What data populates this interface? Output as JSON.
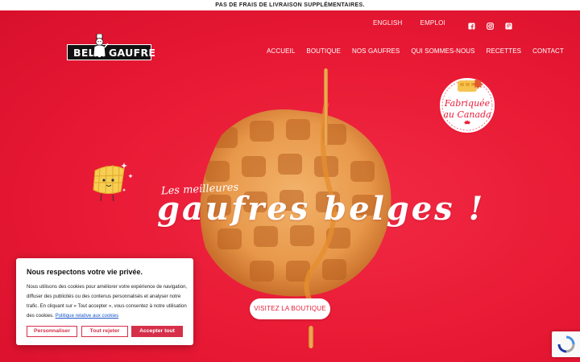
{
  "announcement": "PAS DE FRAIS DE LIVRAISON SUPPLÉMENTAIRES.",
  "top_links": [
    "ENGLISH",
    "EMPLOI"
  ],
  "social": [
    "facebook-icon",
    "instagram-icon",
    "pinterest-icon"
  ],
  "logo": {
    "left": "BEL",
    "right": "GAUFRE"
  },
  "nav": [
    "ACCUEIL",
    "BOUTIQUE",
    "NOS GAUFRES",
    "QUI SOMMES-NOUS",
    "RECETTES",
    "CONTACT"
  ],
  "badge": {
    "line1": "Fabriquée",
    "line2": "au Canada"
  },
  "hero": {
    "tagline_small": "Les meilleures",
    "tagline_big": "gaufres belges !",
    "cta": "VISITEZ LA BOUTIQUE"
  },
  "cookie": {
    "title": "Nous respectons votre vie privée.",
    "body": "Nous utilisons des cookies pour améliorer votre expérience de navigation, diffuser des publicités ou des contenus personnalisés et analyser notre trafic. En cliquant sur « Tout accepter », vous consentez à notre utilisation des cookies.",
    "policy_link": "Politique relative aux cookies",
    "btn_customize": "Personnaliser",
    "btn_reject": "Tout rejeter",
    "btn_accept": "Accepter tout"
  },
  "colors": {
    "brand_red": "#ea1b36",
    "button_red": "#d62f4a",
    "white": "#ffffff"
  }
}
